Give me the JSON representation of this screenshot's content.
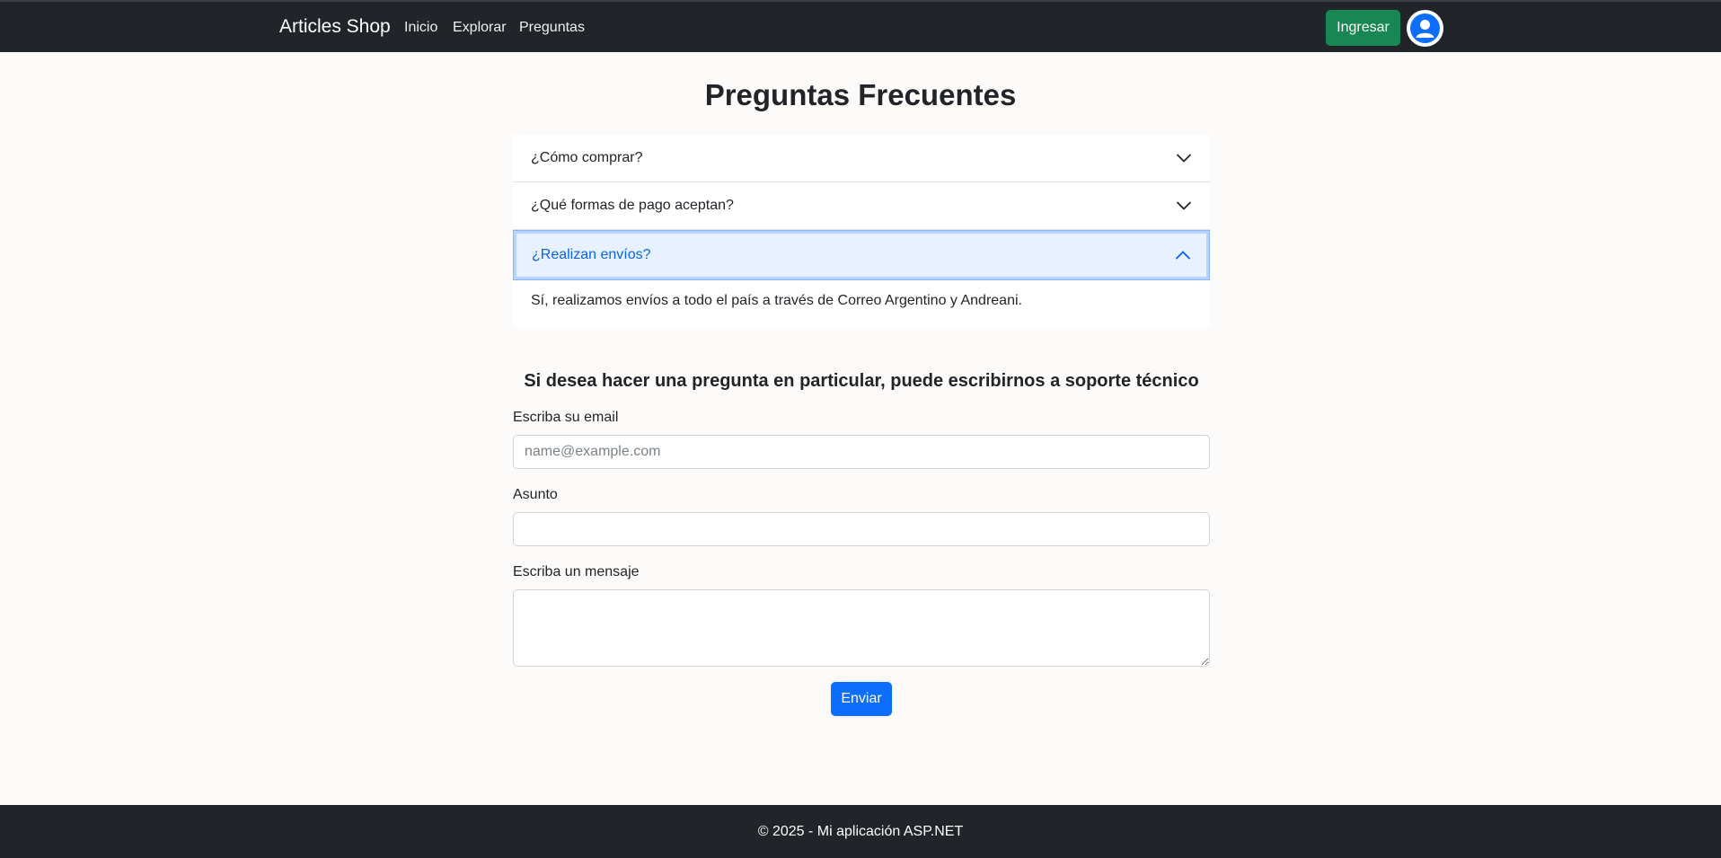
{
  "navbar": {
    "brand": "Articles Shop",
    "links": [
      {
        "label": "Inicio"
      },
      {
        "label": "Explorar"
      },
      {
        "label": "Preguntas"
      }
    ],
    "login_label": "Ingresar",
    "avatar_icon": "user-icon"
  },
  "page": {
    "title": "Preguntas Frecuentes"
  },
  "faq": {
    "items": [
      {
        "question": "¿Cómo comprar?",
        "expanded": false
      },
      {
        "question": "¿Qué formas de pago aceptan?",
        "expanded": false
      },
      {
        "question": "¿Realizan envíos?",
        "expanded": true,
        "answer": "Sí, realizamos envíos a todo el país a través de Correo Argentino y Andreani."
      }
    ]
  },
  "contact": {
    "heading": "Si desea hacer una pregunta en particular, puede escribirnos a soporte técnico",
    "email_label": "Escriba su email",
    "email_placeholder": "name@example.com",
    "email_value": "",
    "subject_label": "Asunto",
    "subject_value": "",
    "message_label": "Escriba un mensaje",
    "message_value": "",
    "send_label": "Enviar"
  },
  "footer": {
    "text": "© 2025 - Mi aplicación ASP.NET"
  },
  "colors": {
    "navbar_bg": "#212529",
    "login_button": "#198754",
    "primary": "#0d6efd",
    "accordion_active_bg": "#e7f1ff",
    "accordion_active_text": "#0c63e4"
  }
}
